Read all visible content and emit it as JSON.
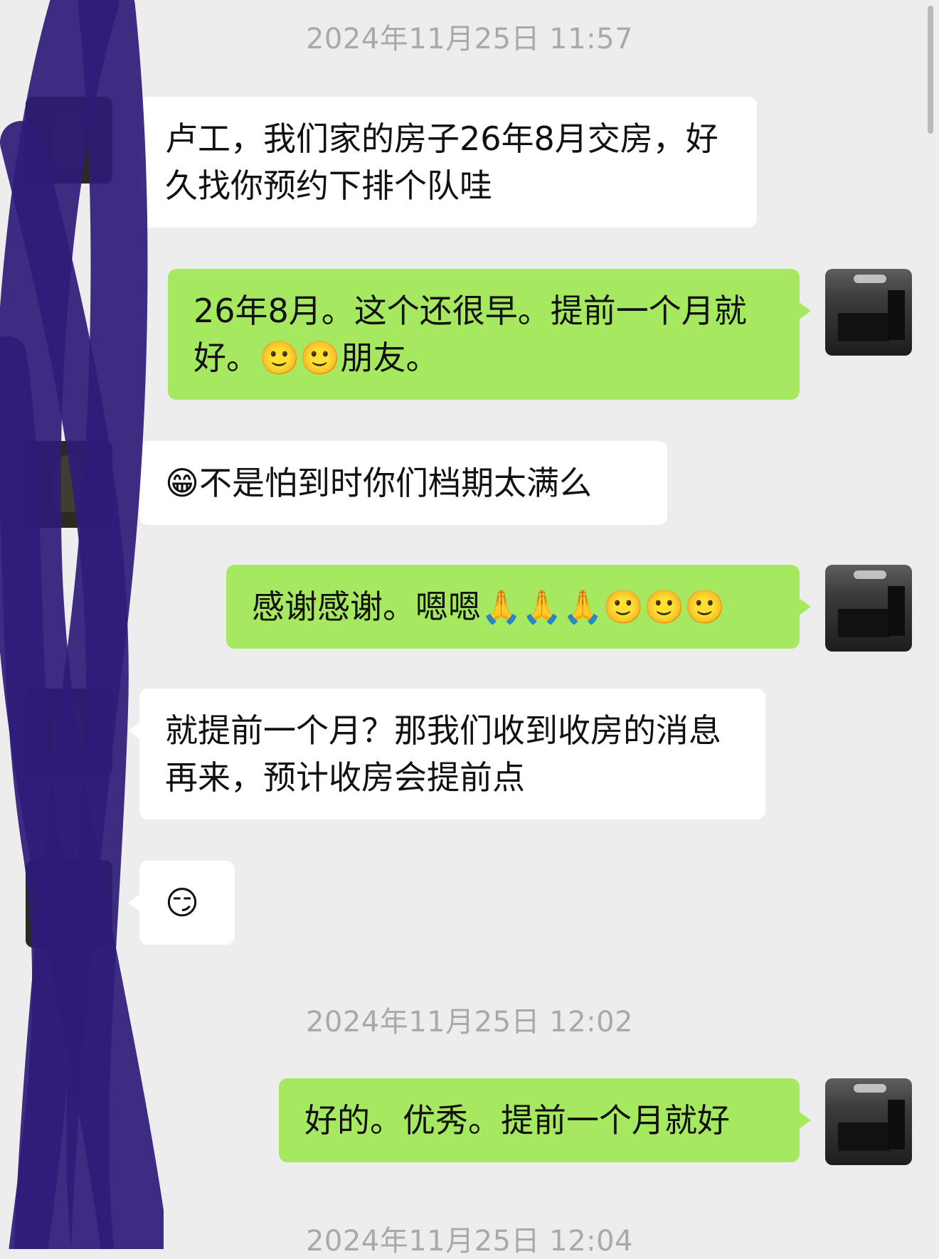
{
  "timestamps": [
    "2024年11月25日 11:57",
    "2024年11月25日 12:02",
    "2024年11月25日 12:04"
  ],
  "messages": [
    {
      "from": "contact",
      "text": "卢工，我们家的房子26年8月交房，好久找你预约下排个队哇"
    },
    {
      "from": "me",
      "text": "26年8月。这个还很早。提前一个月就好。🙂🙂朋友。"
    },
    {
      "from": "contact",
      "text": "😁不是怕到时你们档期太满么"
    },
    {
      "from": "me",
      "text": "感谢感谢。嗯嗯🙏🙏🙏🙂🙂🙂"
    },
    {
      "from": "contact",
      "text": "就提前一个月？那我们收到收房的消息再来，预计收房会提前点"
    },
    {
      "from": "contact",
      "text": "😏"
    },
    {
      "from": "me",
      "text": "好的。优秀。提前一个月就好"
    }
  ],
  "colors": {
    "background": "#ededed",
    "incoming_bubble": "#ffffff",
    "outgoing_bubble": "#a6e860",
    "timestamp": "#a9a9a9",
    "scribble": "#2f1b78"
  }
}
